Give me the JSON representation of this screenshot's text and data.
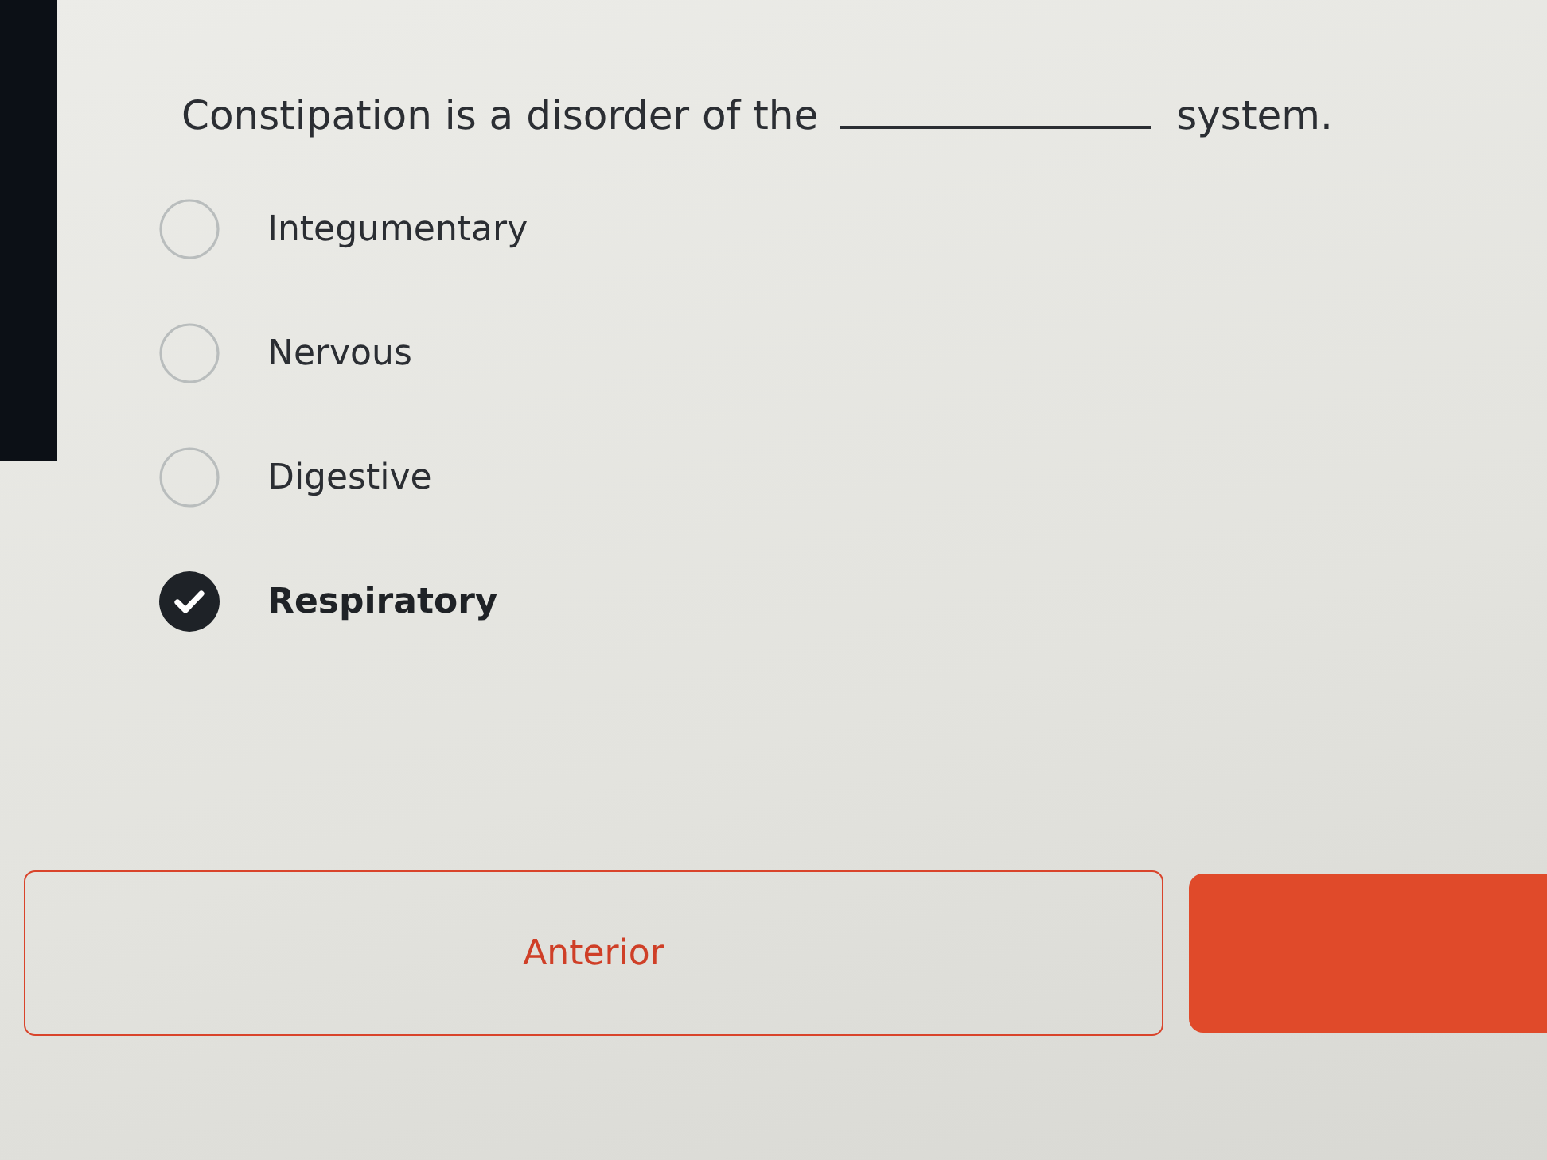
{
  "question": {
    "before_blank": "Constipation is a disorder of the",
    "after_blank": "system."
  },
  "options": [
    {
      "label": "Integumentary",
      "selected": false
    },
    {
      "label": "Nervous",
      "selected": false
    },
    {
      "label": "Digestive",
      "selected": false
    },
    {
      "label": "Respiratory",
      "selected": true
    }
  ],
  "navigation": {
    "previous_button": {
      "label": "Anterior"
    }
  }
}
